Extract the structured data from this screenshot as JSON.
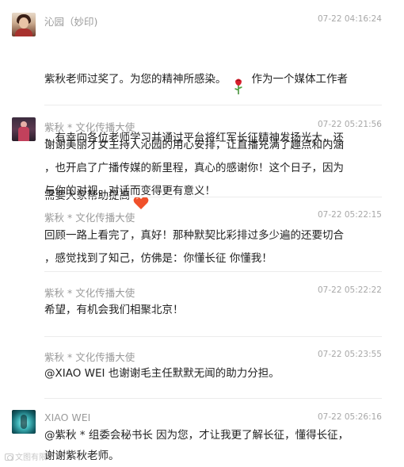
{
  "comments": [
    {
      "author": "沁园（妙印)",
      "time": "07-22 04:16:24",
      "lines": [
        "紫秋老师过奖了。为您的精神所感染。",
        "作为一个媒体工作者",
        "，有幸向各位老师学习并通过平台将红军长征精神发扬光大，还",
        "需要大家帮助提高"
      ],
      "icons": [
        "rose-emoji",
        "heart-emoji"
      ]
    },
    {
      "author": "紫秋 * 文化传播大使",
      "time": "07-22 05:21:56",
      "text": "谢谢美丽才女主持人沁园的用心安排，让直播充满了趣点和内涵\n，也开启了广播传媒的新里程，真心的感谢你！这个日子，因为\n与你的对视、对话而变得更有意义！"
    },
    {
      "author": "紫秋 * 文化传播大使",
      "time": "07-22 05:22:15",
      "text": "回顾一路上看完了，真好！那种默契比彩排过多少遍的还要切合\n，感觉找到了知己，仿佛是：你懂长征 你懂我！"
    },
    {
      "author": "紫秋 * 文化传播大使",
      "time": "07-22 05:22:22",
      "text": "希望，有机会我们相聚北京！"
    },
    {
      "author": "紫秋 * 文化传播大使",
      "time": "07-22 05:23:55",
      "text": "@XIAO  WEI 也谢谢毛主任默默无闻的助力分担。"
    },
    {
      "author": "XIAO  WEI",
      "time": "07-22 05:26:16",
      "text": "@紫秋 * 组委会秘书长 因为您，才让我更了解长征，懂得长征，\n谢谢紫秋老师。"
    }
  ],
  "watermark": "文图有限"
}
